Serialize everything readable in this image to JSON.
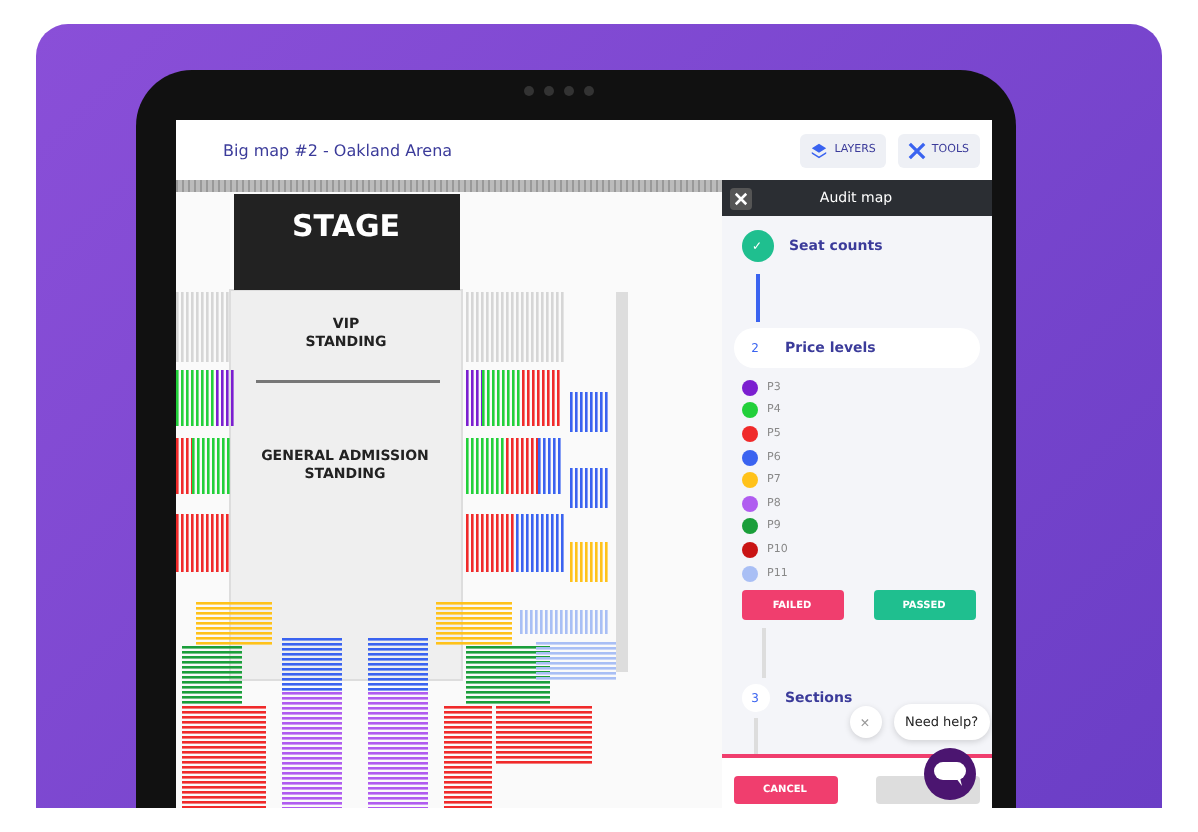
{
  "header": {
    "title": "Big map #2 - Oakland Arena",
    "buttons": [
      {
        "label": "LAYERS",
        "kind": "layers"
      },
      {
        "label": "TOOLS",
        "kind": "tools"
      }
    ]
  },
  "map": {
    "stage": "STAGE",
    "zones": [
      "VIP",
      "STANDING",
      "GENERAL ADMISSION",
      "STANDING"
    ]
  },
  "panel": {
    "title": "Audit map",
    "steps": [
      {
        "marker": "✓",
        "label": "Seat counts",
        "completed": true,
        "selected": false
      },
      {
        "marker": "2",
        "label": "Price levels",
        "completed": false,
        "selected": true,
        "price_levels": [
          {
            "name": "P3",
            "color": "#7b1fd0"
          },
          {
            "name": "P4",
            "color": "#22d03a"
          },
          {
            "name": "P5",
            "color": "#f02a2a"
          },
          {
            "name": "P6",
            "color": "#3a63f0"
          },
          {
            "name": "P7",
            "color": "#ffc21a"
          },
          {
            "name": "P8",
            "color": "#b05cf0"
          },
          {
            "name": "P9",
            "color": "#1a9e3a"
          },
          {
            "name": "P10",
            "color": "#c91414"
          },
          {
            "name": "P11",
            "color": "#a9bff5"
          }
        ],
        "actions": [
          {
            "label": "FAILED",
            "kind": "fail"
          },
          {
            "label": "PASSED",
            "kind": "pass"
          }
        ]
      },
      {
        "marker": "3",
        "label": "Sections",
        "completed": false,
        "selected": false
      }
    ],
    "footer": [
      {
        "label": "CANCEL",
        "disabled": false
      },
      {
        "disabled": true
      }
    ]
  },
  "chat": {
    "prompt": "Need help?",
    "close": "×"
  }
}
